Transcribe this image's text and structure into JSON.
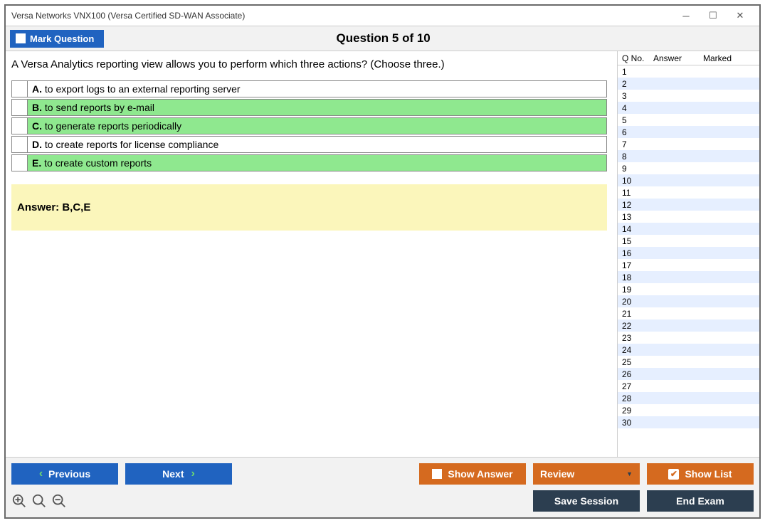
{
  "window": {
    "title": "Versa Networks VNX100 (Versa Certified SD-WAN Associate)"
  },
  "header": {
    "mark_label": "Mark Question",
    "question_title": "Question 5 of 10"
  },
  "question": {
    "text": "A Versa Analytics reporting view allows you to perform which three actions? (Choose three.)",
    "options": [
      {
        "letter": "A.",
        "text": "to export logs to an external reporting server",
        "correct": false
      },
      {
        "letter": "B.",
        "text": "to send reports by e-mail",
        "correct": true
      },
      {
        "letter": "C.",
        "text": "to generate reports periodically",
        "correct": true
      },
      {
        "letter": "D.",
        "text": "to create reports for license compliance",
        "correct": false
      },
      {
        "letter": "E.",
        "text": "to create custom reports",
        "correct": true
      }
    ],
    "answer_label": "Answer: B,C,E"
  },
  "sidepanel": {
    "col1": "Q No.",
    "col2": "Answer",
    "col3": "Marked",
    "row_count": 30
  },
  "buttons": {
    "previous": "Previous",
    "next": "Next",
    "show_answer": "Show Answer",
    "review": "Review",
    "show_list": "Show List",
    "save_session": "Save Session",
    "end_exam": "End Exam"
  },
  "icons": {
    "zoom_in": "zoom-in-icon",
    "zoom_reset": "zoom-icon",
    "zoom_out": "zoom-out-icon"
  }
}
